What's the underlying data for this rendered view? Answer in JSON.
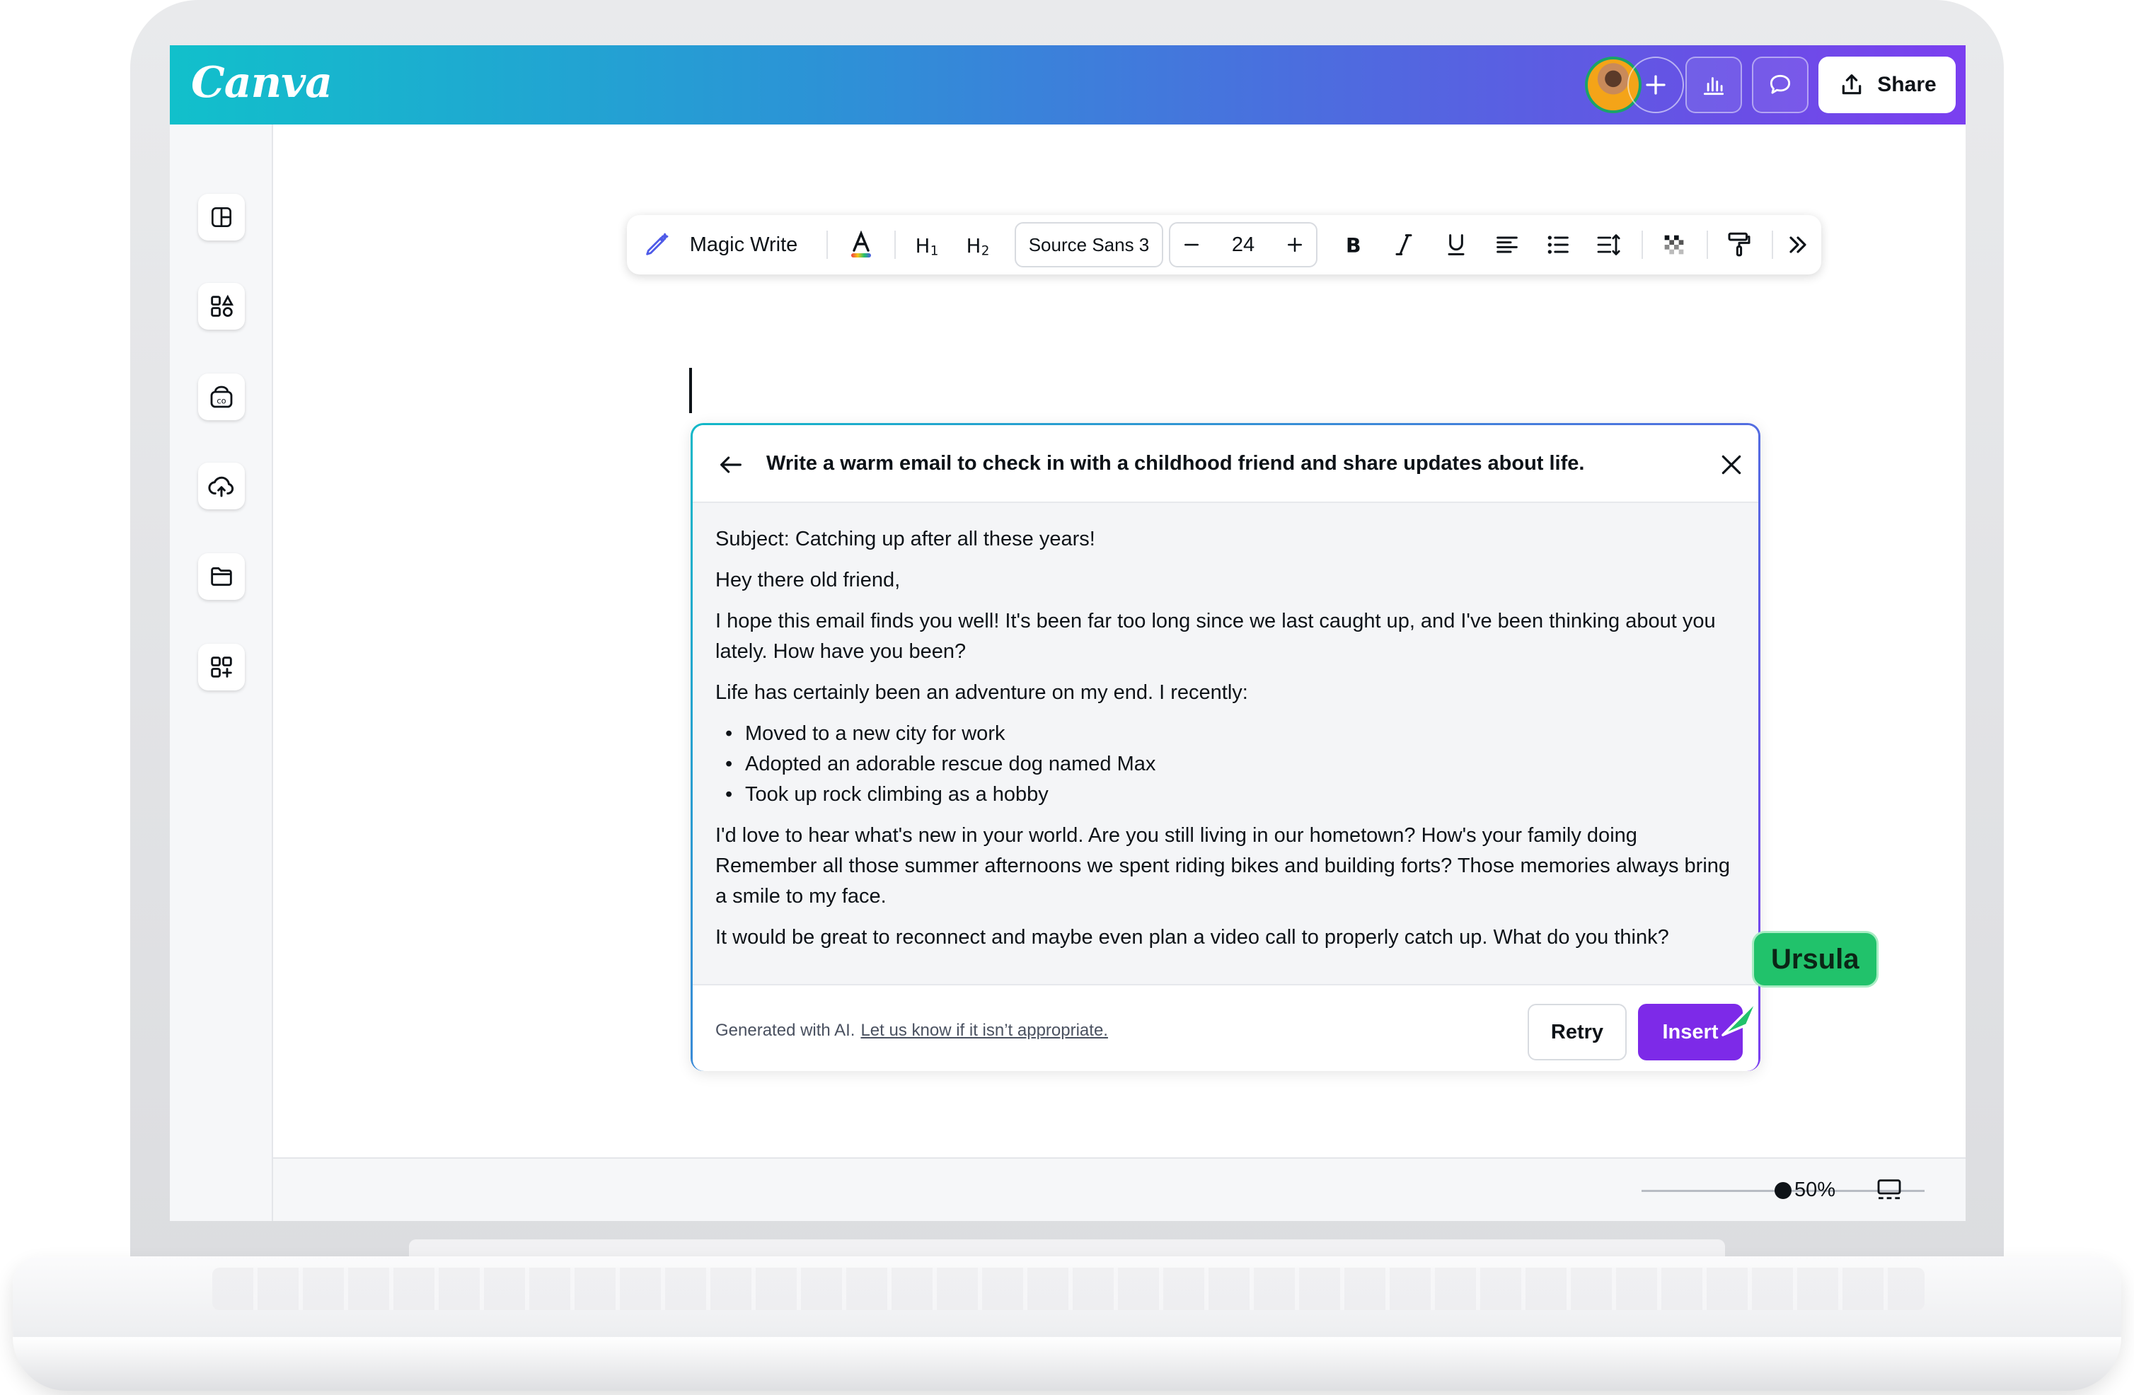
{
  "app": {
    "logo_text": "Canva",
    "brand_colors": {
      "header_start": "#11c0cb",
      "header_end": "#7b3ff0",
      "primary": "#7d2ae8",
      "collaborator": "#21c26b"
    }
  },
  "header": {
    "share_label": "Share",
    "avatar_icon": "user-avatar",
    "add_icon": "plus-icon",
    "insights_icon": "bar-chart-icon",
    "comment_icon": "speech-bubble-icon",
    "share_icon": "upload-icon"
  },
  "sidebar": {
    "items": [
      {
        "icon": "layout-icon"
      },
      {
        "icon": "elements-icon"
      },
      {
        "icon": "brand-icon"
      },
      {
        "icon": "upload-cloud-icon"
      },
      {
        "icon": "folder-icon"
      },
      {
        "icon": "apps-icon"
      }
    ],
    "magic_icon": "sparkle-icon"
  },
  "toolbar": {
    "magic_write_label": "Magic Write",
    "font_name": "Source Sans 3",
    "font_size": "24",
    "icons": [
      "magic-pen-icon",
      "text-color-icon",
      "heading-1-icon",
      "heading-2-icon",
      "minus-icon",
      "plus-icon",
      "bold-icon",
      "italic-icon",
      "underline-icon",
      "align-left-icon",
      "bullet-list-icon",
      "line-spacing-icon",
      "transparency-icon",
      "paint-roller-icon",
      "more-chevrons-icon"
    ]
  },
  "panel": {
    "prompt": "Write a warm email to check in with a childhood friend and share updates about life.",
    "body": {
      "subject": "Subject: Catching up after all these years!",
      "greeting": "Hey there old friend,",
      "para1": "I hope this email finds you well! It's been far too long since we last caught up, and I've been thinking about you lately. How have you been?",
      "para2": "Life has certainly been an adventure on my end. I recently:",
      "bullets": [
        "Moved to a new city for work",
        "Adopted an adorable rescue dog named Max",
        "Took up rock climbing as a hobby"
      ],
      "para3": "I'd love to hear what's new in your world. Are you still living in our hometown? How's your family doing Remember all those summer afternoons we spent riding bikes and building forts? Those memories always bring a smile to my face.",
      "para4": "It would be great to reconnect and maybe even plan a video call to properly catch up. What do you think?"
    },
    "footer": {
      "generated_text": "Generated with AI.",
      "feedback_link": "Let us know if it isn’t appropriate.",
      "retry_label": "Retry",
      "insert_label": "Insert"
    }
  },
  "collaborator": {
    "name": "Ursula"
  },
  "bottom_bar": {
    "zoom": "50%",
    "zoom_fraction": 0.5
  }
}
